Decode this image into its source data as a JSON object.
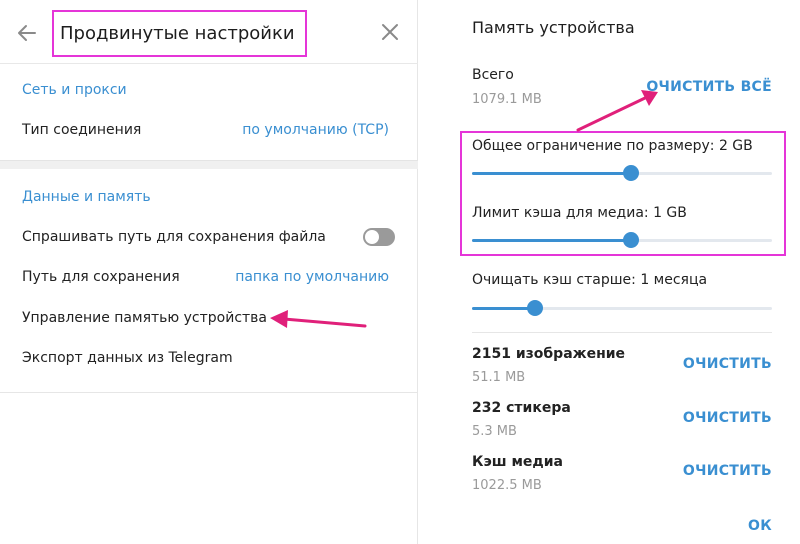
{
  "left_panel": {
    "title": "Продвинутые настройки",
    "network": {
      "section_title": "Сеть и прокси",
      "connection_type_label": "Тип соединения",
      "connection_type_value": "по умолчанию (TCP)"
    },
    "data": {
      "section_title": "Данные и память",
      "ask_path_label": "Спрашивать путь для сохранения файла",
      "ask_path_enabled": false,
      "save_path_label": "Путь для сохранения",
      "save_path_value": "папка по умолчанию",
      "storage_label": "Управление памятью устройства",
      "export_label": "Экспорт данных из Telegram"
    }
  },
  "right_panel": {
    "title": "Память устройства",
    "total": {
      "label": "Всего",
      "size": "1079.1 MB",
      "clear_all": "ОЧИСТИТЬ ВСЁ"
    },
    "sliders": [
      {
        "label": "Общее ограничение по размеру: 2 GB",
        "fraction": 0.53
      },
      {
        "label": "Лимит кэша для медиа: 1 GB",
        "fraction": 0.53
      },
      {
        "label": "Очищать кэш старше: 1 месяца",
        "fraction": 0.21
      }
    ],
    "categories": [
      {
        "name": "2151 изображение",
        "size": "51.1 MB",
        "action": "ОЧИСТИТЬ"
      },
      {
        "name": "232 стикера",
        "size": "5.3 MB",
        "action": "ОЧИСТИТЬ"
      },
      {
        "name": "Кэш медиа",
        "size": "1022.5 MB",
        "action": "ОЧИСТИТЬ"
      }
    ],
    "ok": "ОК"
  },
  "colors": {
    "accent": "#3a8fd1",
    "highlight": "#e535d8",
    "arrow": "#e0207a"
  },
  "icons": {
    "back": "arrow-left-icon",
    "close": "close-icon"
  }
}
